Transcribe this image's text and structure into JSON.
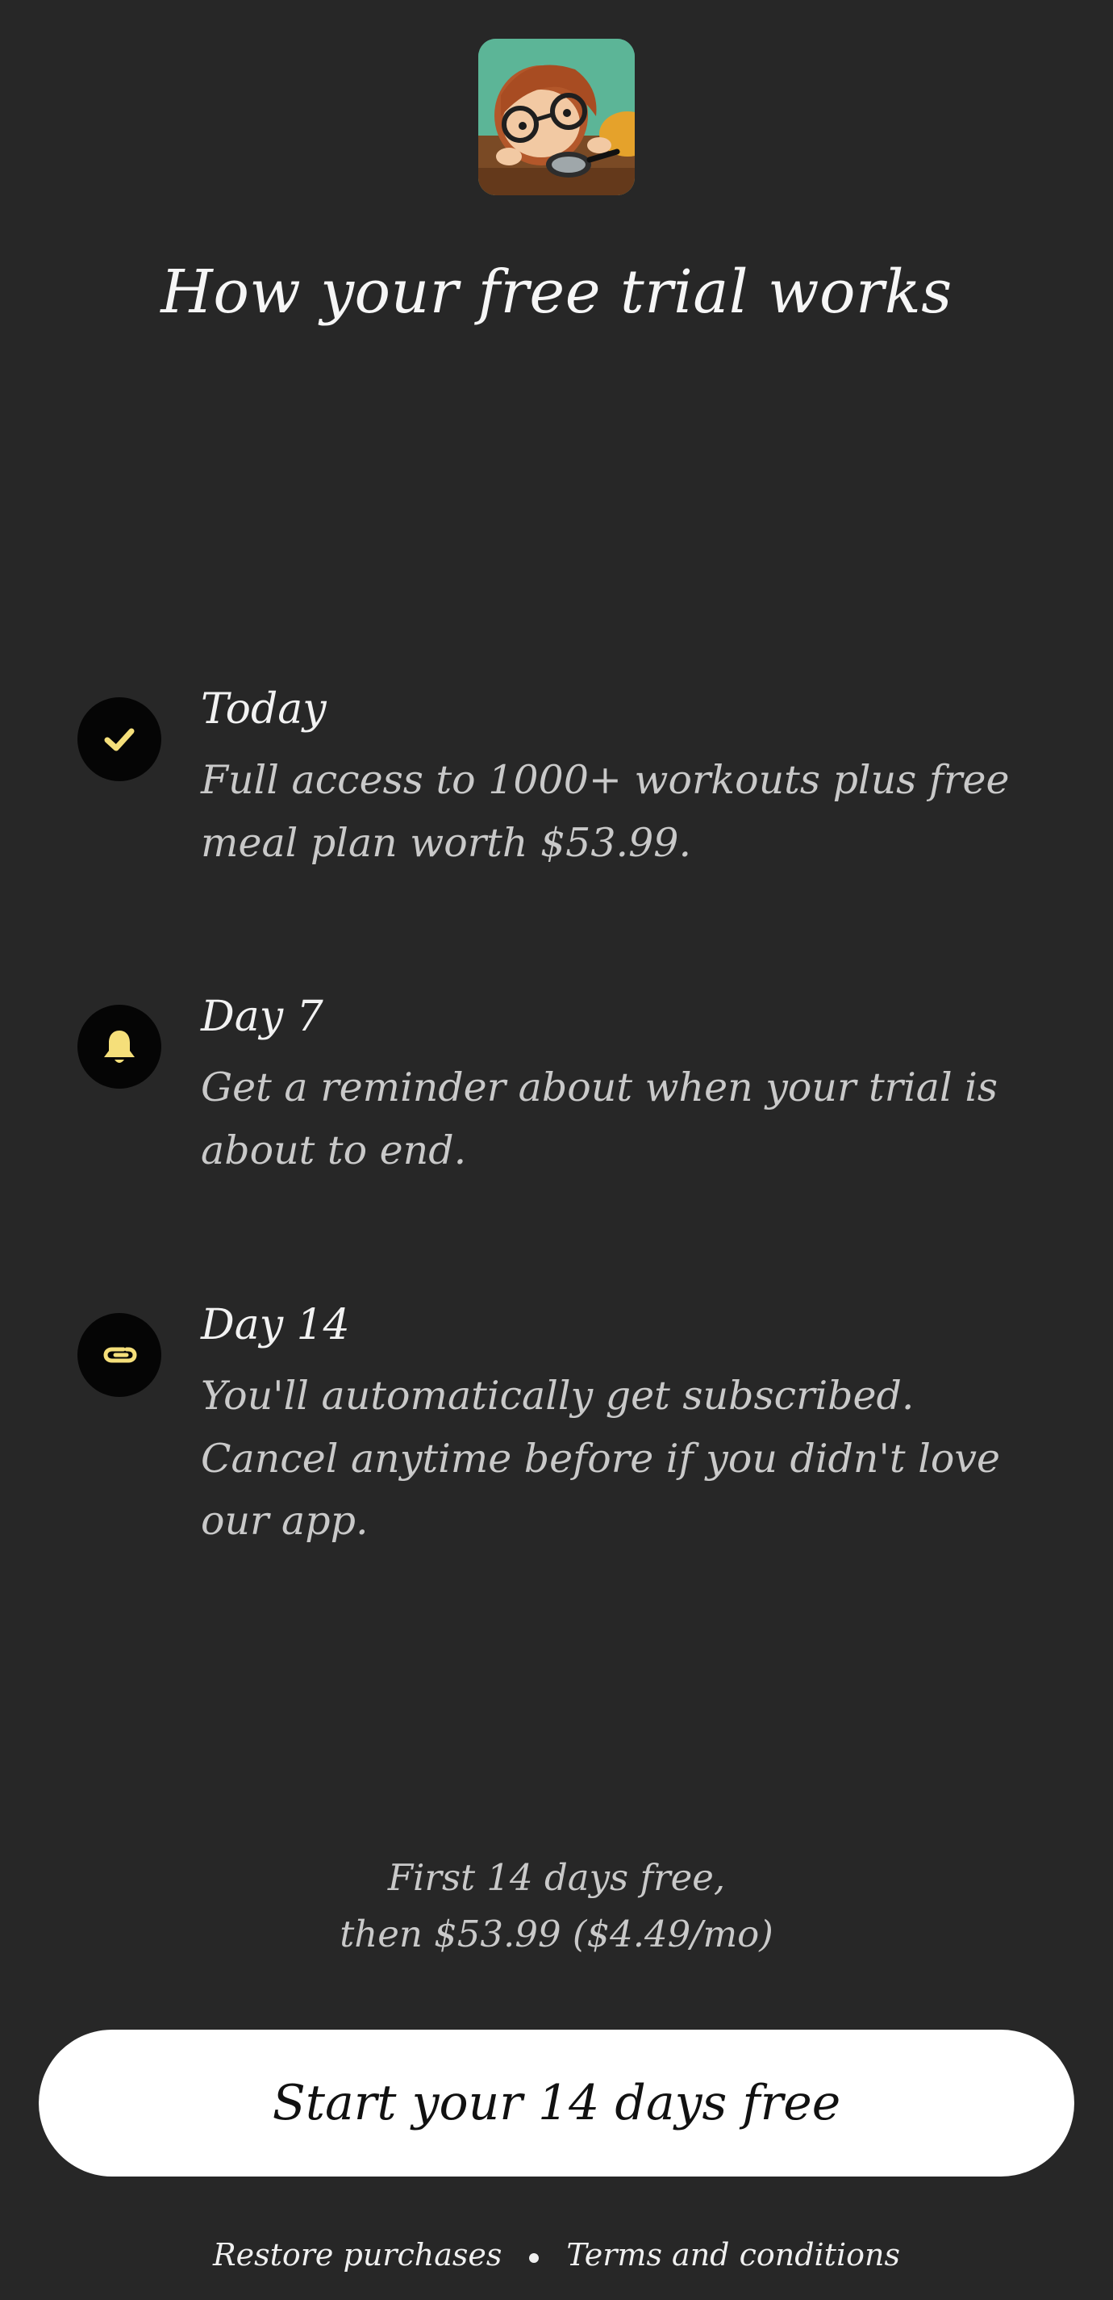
{
  "header": {
    "app_icon": "cartoon-child-with-glasses-and-magnifying-glass",
    "title": "How your free trial works"
  },
  "timeline": [
    {
      "icon": "check-icon",
      "heading": "Today",
      "description": "Full access to 1000+ workouts plus free meal plan worth $53.99."
    },
    {
      "icon": "bell-icon",
      "heading": "Day 7",
      "description": "Get a reminder about when your trial is about to end."
    },
    {
      "icon": "paperclip-icon",
      "heading": "Day 14",
      "description": "You'll automatically get subscribed. Cancel anytime before if you didn't love our app."
    }
  ],
  "pricing": {
    "line1": "First 14 days free,",
    "line2": "then $53.99 ($4.49/mo)"
  },
  "cta": {
    "label": "Start your 14 days free"
  },
  "footer": {
    "restore_label": "Restore purchases",
    "terms_label": "Terms and conditions"
  },
  "colors": {
    "background": "#272727",
    "accent": "#f5df7a",
    "button_bg": "#ffffff",
    "icon_circle": "#050505"
  }
}
